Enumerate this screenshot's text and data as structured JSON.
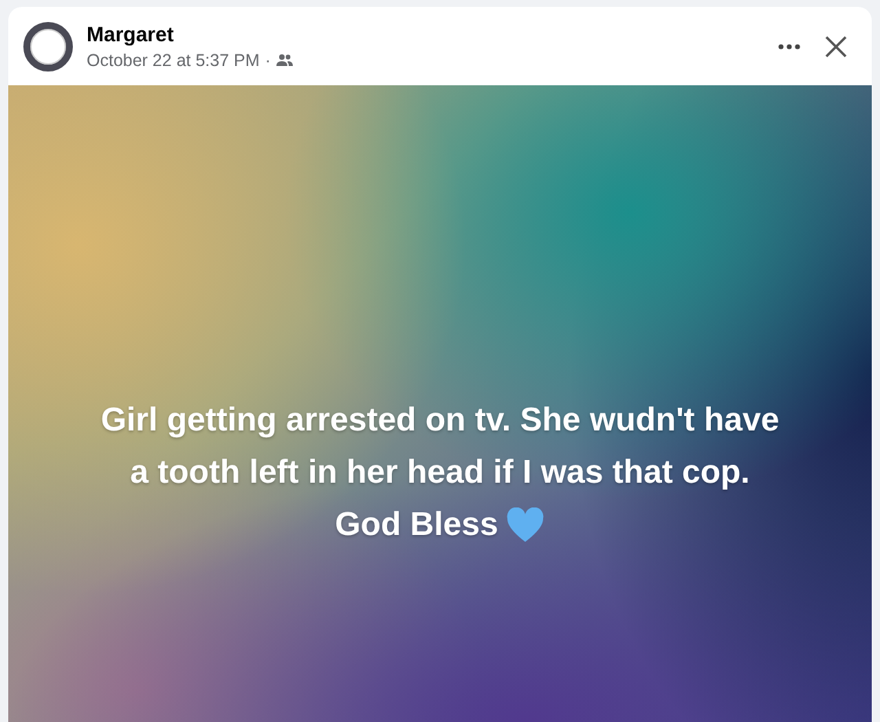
{
  "post": {
    "author": "Margaret",
    "timestamp": "October 22 at 5:37 PM",
    "audience_separator": "·",
    "text_lines": [
      "Girl getting arrested on tv. She wudn't have",
      "a tooth left in her head if I was that cop.",
      "God Bless"
    ]
  }
}
